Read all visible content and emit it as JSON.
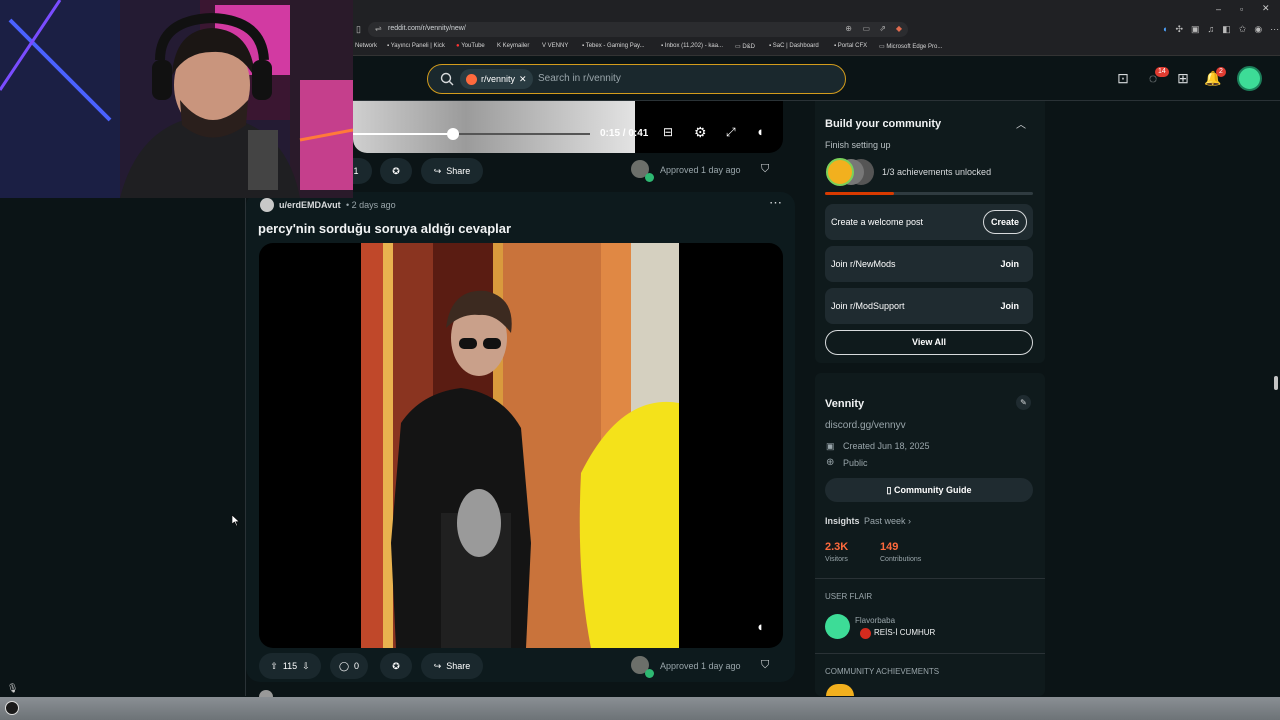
{
  "browser": {
    "url": "reddit.com/r/vennity/new/",
    "bookmarks": [
      "Network",
      "Yayıncı Paneli | Kick",
      "YouTube",
      "Keymailer",
      "VENNY",
      "Tebex - Gaming Pay...",
      "Inbox (11,202) - kaa...",
      "D&D",
      "SaC | Dashboard",
      "Portal CFX",
      "Microsoft Edge Pro..."
    ]
  },
  "header": {
    "subreddit_chip": "r/vennity",
    "search_placeholder": "Search in r/vennity",
    "chat_badge": "14",
    "notif_badge": "2"
  },
  "top_post": {
    "time_display": "0:15 / 0:41",
    "vote_count": "1",
    "share_label": "Share",
    "approved_text": "Approved 1 day ago",
    "progress": 0.42
  },
  "post": {
    "author": "u/erdEMDAvut",
    "age": "• 2 days ago",
    "title": "percy'nin sorduğu soruya aldığı cevaplar",
    "votes": "115",
    "comments": "0",
    "share_label": "Share",
    "approved_text": "Approved 1 day ago"
  },
  "sidebar": {
    "build": {
      "title": "Build your community",
      "subtitle": "Finish setting up",
      "achievements": "1/3 achievements unlocked",
      "progress": 0.33,
      "welcome_label": "Create a welcome post",
      "create_label": "Create",
      "newmods_label": "Join r/NewMods",
      "modsupport_label": "Join r/ModSupport",
      "join_label": "Join",
      "view_all": "View All"
    },
    "about": {
      "name": "Vennity",
      "link": "discord.gg/vennyv",
      "created": "Created Jun 18, 2025",
      "visibility": "Public",
      "guide": "Community Guide",
      "insights": "Insights",
      "insights_range": "Past week",
      "visitors_value": "2.3K",
      "visitors_label": "Visitors",
      "contrib_value": "149",
      "contrib_label": "Contributions"
    },
    "flair": {
      "heading": "USER FLAIR",
      "username": "Flavorbaba",
      "flair": "REİS-İ CUMHUR"
    },
    "achievements_heading": "COMMUNITY ACHIEVEMENTS"
  },
  "colors": {
    "accent": "#d39c1c",
    "brand_orange": "#ff4500",
    "stat_orange": "#ff6a3d",
    "approved_green": "#2eb872"
  }
}
